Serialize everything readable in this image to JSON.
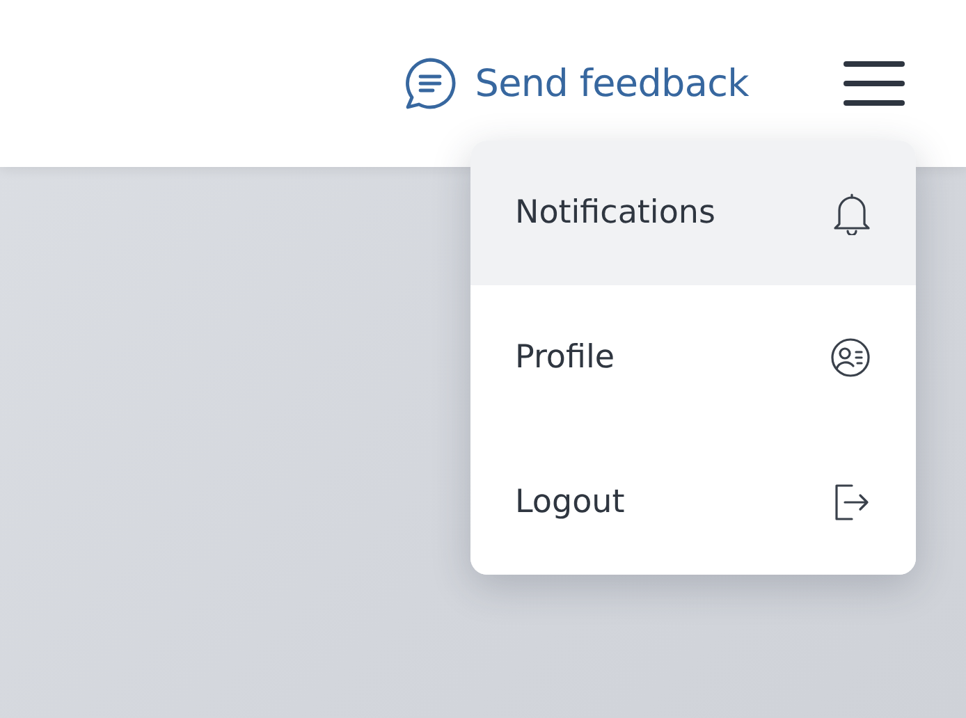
{
  "header": {
    "feedback_label": "Send feedback"
  },
  "menu": {
    "items": [
      {
        "label": "Notifications",
        "kind": "bell",
        "selected": true
      },
      {
        "label": "Profile",
        "kind": "profile",
        "selected": false
      },
      {
        "label": "Logout",
        "kind": "logout",
        "selected": false
      }
    ]
  }
}
